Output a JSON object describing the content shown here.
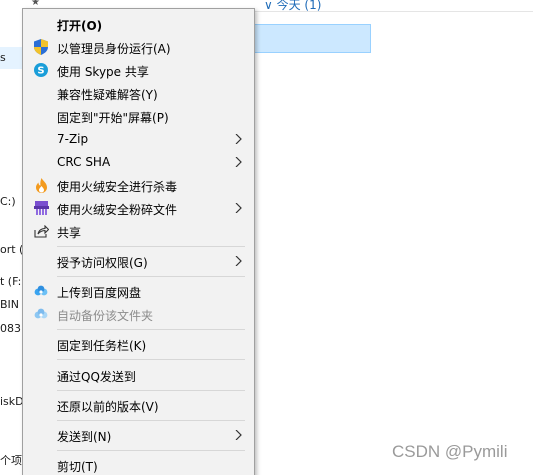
{
  "background": {
    "header_text": "∨ 今天 (1)",
    "left_fragments": [
      "s",
      "C:)",
      "ort (",
      "t (F:",
      "BIN",
      "083:",
      "iskD",
      "个项"
    ],
    "watermark": "CSDN @Pymili"
  },
  "menu": {
    "items": [
      {
        "label": "打开(O)",
        "icon": null
      },
      {
        "label": "以管理员身份运行(A)",
        "icon": "uac-shield-icon"
      },
      {
        "label": "使用 Skype 共享",
        "icon": "skype-icon"
      },
      {
        "label": "兼容性疑难解答(Y)",
        "icon": null
      },
      {
        "label": "固定到\"开始\"屏幕(P)",
        "icon": null
      },
      {
        "label": "7-Zip",
        "icon": null,
        "submenu": true
      },
      {
        "label": "CRC SHA",
        "icon": null,
        "submenu": true
      },
      {
        "label": "使用火绒安全进行杀毒",
        "icon": "huorong-flame-icon"
      },
      {
        "label": "使用火绒安全粉碎文件",
        "icon": "shredder-icon",
        "submenu": true
      },
      {
        "label": "共享",
        "icon": "share-icon"
      },
      {
        "label": "授予访问权限(G)",
        "icon": null,
        "submenu": true
      },
      {
        "label": "上传到百度网盘",
        "icon": "baidu-cloud-icon"
      },
      {
        "label": "自动备份该文件夹",
        "icon": "baidu-cloud-icon",
        "disabled": true
      },
      {
        "label": "固定到任务栏(K)",
        "icon": null
      },
      {
        "label": "通过QQ发送到",
        "icon": null
      },
      {
        "label": "还原以前的版本(V)",
        "icon": null
      },
      {
        "label": "发送到(N)",
        "icon": null,
        "submenu": true
      },
      {
        "label": "剪切(T)",
        "icon": null
      }
    ]
  },
  "colors": {
    "menu_bg": "#f2f2f2",
    "selection_bg": "#cce8ff",
    "selection_border": "#99d1ff",
    "disabled_text": "#8c8c8c",
    "header_link": "#1e6bb8"
  }
}
